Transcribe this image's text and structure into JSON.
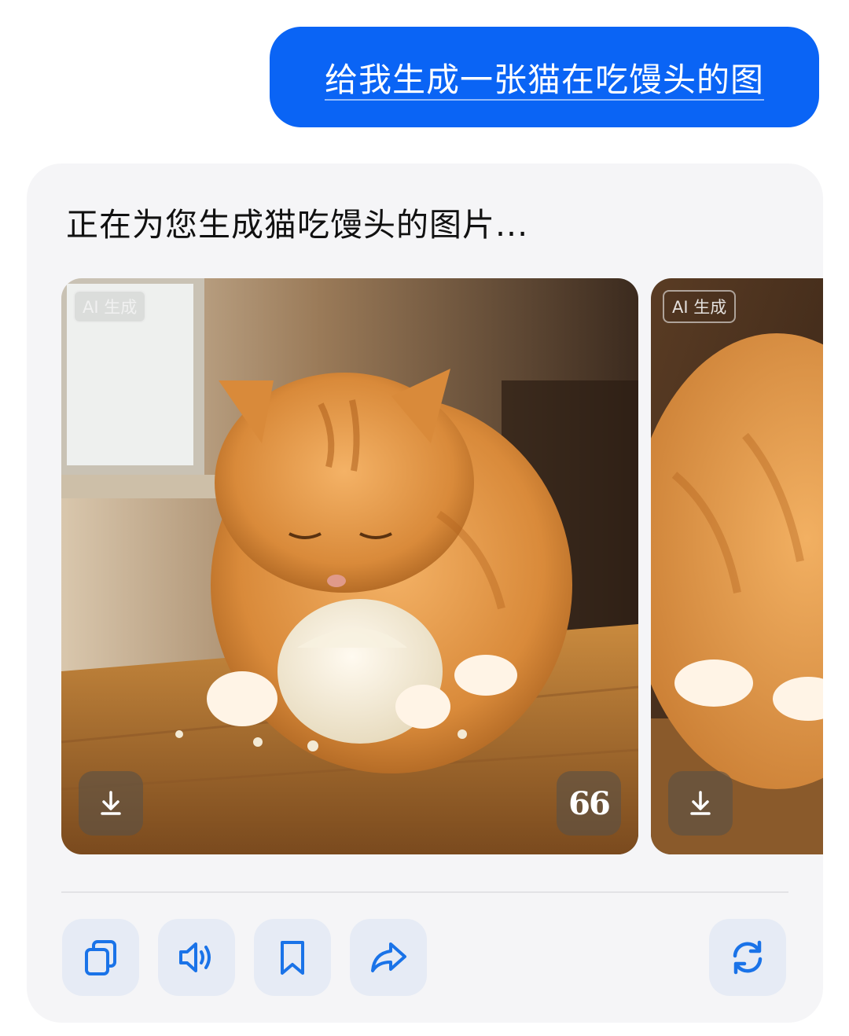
{
  "user_message": {
    "text": "给我生成一张猫在吃馒头的图"
  },
  "assistant_reply": {
    "text": "正在为您生成猫吃馒头的图片...",
    "images": [
      {
        "badge": "AI 生成",
        "description_icon": "cat-eating-bun-image"
      },
      {
        "badge": "AI 生成",
        "description_icon": "cat-eating-bun-image"
      }
    ],
    "quote_label": "66"
  },
  "actions": [
    {
      "icon": "copy-icon"
    },
    {
      "icon": "speaker-icon"
    },
    {
      "icon": "bookmark-icon"
    },
    {
      "icon": "share-icon"
    },
    {
      "icon": "regenerate-icon"
    }
  ],
  "colors": {
    "accent": "#0a64f5",
    "icon_blue": "#1a73e8",
    "card_bg": "#f5f5f7",
    "action_bg": "#e6ebf5"
  }
}
